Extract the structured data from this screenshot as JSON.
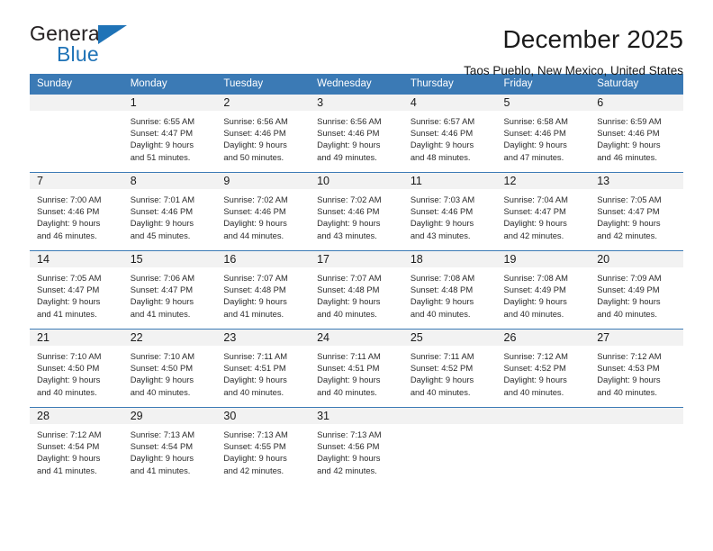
{
  "brand": {
    "name_part1": "General",
    "name_part2": "Blue",
    "accent_color": "#1f73b7",
    "logo_icon": "triangle-flag-icon"
  },
  "header": {
    "title": "December 2025",
    "subtitle": "Taos Pueblo, New Mexico, United States"
  },
  "calendar": {
    "header_bg": "#3b7ab5",
    "daynum_bg": "#f2f2f2",
    "weekday_headers": [
      "Sunday",
      "Monday",
      "Tuesday",
      "Wednesday",
      "Thursday",
      "Friday",
      "Saturday"
    ],
    "weeks": [
      [
        {
          "day": "",
          "sunrise": "",
          "sunset": "",
          "daylight_line1": "",
          "daylight_line2": ""
        },
        {
          "day": "1",
          "sunrise": "Sunrise: 6:55 AM",
          "sunset": "Sunset: 4:47 PM",
          "daylight_line1": "Daylight: 9 hours",
          "daylight_line2": "and 51 minutes."
        },
        {
          "day": "2",
          "sunrise": "Sunrise: 6:56 AM",
          "sunset": "Sunset: 4:46 PM",
          "daylight_line1": "Daylight: 9 hours",
          "daylight_line2": "and 50 minutes."
        },
        {
          "day": "3",
          "sunrise": "Sunrise: 6:56 AM",
          "sunset": "Sunset: 4:46 PM",
          "daylight_line1": "Daylight: 9 hours",
          "daylight_line2": "and 49 minutes."
        },
        {
          "day": "4",
          "sunrise": "Sunrise: 6:57 AM",
          "sunset": "Sunset: 4:46 PM",
          "daylight_line1": "Daylight: 9 hours",
          "daylight_line2": "and 48 minutes."
        },
        {
          "day": "5",
          "sunrise": "Sunrise: 6:58 AM",
          "sunset": "Sunset: 4:46 PM",
          "daylight_line1": "Daylight: 9 hours",
          "daylight_line2": "and 47 minutes."
        },
        {
          "day": "6",
          "sunrise": "Sunrise: 6:59 AM",
          "sunset": "Sunset: 4:46 PM",
          "daylight_line1": "Daylight: 9 hours",
          "daylight_line2": "and 46 minutes."
        }
      ],
      [
        {
          "day": "7",
          "sunrise": "Sunrise: 7:00 AM",
          "sunset": "Sunset: 4:46 PM",
          "daylight_line1": "Daylight: 9 hours",
          "daylight_line2": "and 46 minutes."
        },
        {
          "day": "8",
          "sunrise": "Sunrise: 7:01 AM",
          "sunset": "Sunset: 4:46 PM",
          "daylight_line1": "Daylight: 9 hours",
          "daylight_line2": "and 45 minutes."
        },
        {
          "day": "9",
          "sunrise": "Sunrise: 7:02 AM",
          "sunset": "Sunset: 4:46 PM",
          "daylight_line1": "Daylight: 9 hours",
          "daylight_line2": "and 44 minutes."
        },
        {
          "day": "10",
          "sunrise": "Sunrise: 7:02 AM",
          "sunset": "Sunset: 4:46 PM",
          "daylight_line1": "Daylight: 9 hours",
          "daylight_line2": "and 43 minutes."
        },
        {
          "day": "11",
          "sunrise": "Sunrise: 7:03 AM",
          "sunset": "Sunset: 4:46 PM",
          "daylight_line1": "Daylight: 9 hours",
          "daylight_line2": "and 43 minutes."
        },
        {
          "day": "12",
          "sunrise": "Sunrise: 7:04 AM",
          "sunset": "Sunset: 4:47 PM",
          "daylight_line1": "Daylight: 9 hours",
          "daylight_line2": "and 42 minutes."
        },
        {
          "day": "13",
          "sunrise": "Sunrise: 7:05 AM",
          "sunset": "Sunset: 4:47 PM",
          "daylight_line1": "Daylight: 9 hours",
          "daylight_line2": "and 42 minutes."
        }
      ],
      [
        {
          "day": "14",
          "sunrise": "Sunrise: 7:05 AM",
          "sunset": "Sunset: 4:47 PM",
          "daylight_line1": "Daylight: 9 hours",
          "daylight_line2": "and 41 minutes."
        },
        {
          "day": "15",
          "sunrise": "Sunrise: 7:06 AM",
          "sunset": "Sunset: 4:47 PM",
          "daylight_line1": "Daylight: 9 hours",
          "daylight_line2": "and 41 minutes."
        },
        {
          "day": "16",
          "sunrise": "Sunrise: 7:07 AM",
          "sunset": "Sunset: 4:48 PM",
          "daylight_line1": "Daylight: 9 hours",
          "daylight_line2": "and 41 minutes."
        },
        {
          "day": "17",
          "sunrise": "Sunrise: 7:07 AM",
          "sunset": "Sunset: 4:48 PM",
          "daylight_line1": "Daylight: 9 hours",
          "daylight_line2": "and 40 minutes."
        },
        {
          "day": "18",
          "sunrise": "Sunrise: 7:08 AM",
          "sunset": "Sunset: 4:48 PM",
          "daylight_line1": "Daylight: 9 hours",
          "daylight_line2": "and 40 minutes."
        },
        {
          "day": "19",
          "sunrise": "Sunrise: 7:08 AM",
          "sunset": "Sunset: 4:49 PM",
          "daylight_line1": "Daylight: 9 hours",
          "daylight_line2": "and 40 minutes."
        },
        {
          "day": "20",
          "sunrise": "Sunrise: 7:09 AM",
          "sunset": "Sunset: 4:49 PM",
          "daylight_line1": "Daylight: 9 hours",
          "daylight_line2": "and 40 minutes."
        }
      ],
      [
        {
          "day": "21",
          "sunrise": "Sunrise: 7:10 AM",
          "sunset": "Sunset: 4:50 PM",
          "daylight_line1": "Daylight: 9 hours",
          "daylight_line2": "and 40 minutes."
        },
        {
          "day": "22",
          "sunrise": "Sunrise: 7:10 AM",
          "sunset": "Sunset: 4:50 PM",
          "daylight_line1": "Daylight: 9 hours",
          "daylight_line2": "and 40 minutes."
        },
        {
          "day": "23",
          "sunrise": "Sunrise: 7:11 AM",
          "sunset": "Sunset: 4:51 PM",
          "daylight_line1": "Daylight: 9 hours",
          "daylight_line2": "and 40 minutes."
        },
        {
          "day": "24",
          "sunrise": "Sunrise: 7:11 AM",
          "sunset": "Sunset: 4:51 PM",
          "daylight_line1": "Daylight: 9 hours",
          "daylight_line2": "and 40 minutes."
        },
        {
          "day": "25",
          "sunrise": "Sunrise: 7:11 AM",
          "sunset": "Sunset: 4:52 PM",
          "daylight_line1": "Daylight: 9 hours",
          "daylight_line2": "and 40 minutes."
        },
        {
          "day": "26",
          "sunrise": "Sunrise: 7:12 AM",
          "sunset": "Sunset: 4:52 PM",
          "daylight_line1": "Daylight: 9 hours",
          "daylight_line2": "and 40 minutes."
        },
        {
          "day": "27",
          "sunrise": "Sunrise: 7:12 AM",
          "sunset": "Sunset: 4:53 PM",
          "daylight_line1": "Daylight: 9 hours",
          "daylight_line2": "and 40 minutes."
        }
      ],
      [
        {
          "day": "28",
          "sunrise": "Sunrise: 7:12 AM",
          "sunset": "Sunset: 4:54 PM",
          "daylight_line1": "Daylight: 9 hours",
          "daylight_line2": "and 41 minutes."
        },
        {
          "day": "29",
          "sunrise": "Sunrise: 7:13 AM",
          "sunset": "Sunset: 4:54 PM",
          "daylight_line1": "Daylight: 9 hours",
          "daylight_line2": "and 41 minutes."
        },
        {
          "day": "30",
          "sunrise": "Sunrise: 7:13 AM",
          "sunset": "Sunset: 4:55 PM",
          "daylight_line1": "Daylight: 9 hours",
          "daylight_line2": "and 42 minutes."
        },
        {
          "day": "31",
          "sunrise": "Sunrise: 7:13 AM",
          "sunset": "Sunset: 4:56 PM",
          "daylight_line1": "Daylight: 9 hours",
          "daylight_line2": "and 42 minutes."
        },
        {
          "day": "",
          "sunrise": "",
          "sunset": "",
          "daylight_line1": "",
          "daylight_line2": ""
        },
        {
          "day": "",
          "sunrise": "",
          "sunset": "",
          "daylight_line1": "",
          "daylight_line2": ""
        },
        {
          "day": "",
          "sunrise": "",
          "sunset": "",
          "daylight_line1": "",
          "daylight_line2": ""
        }
      ]
    ]
  }
}
